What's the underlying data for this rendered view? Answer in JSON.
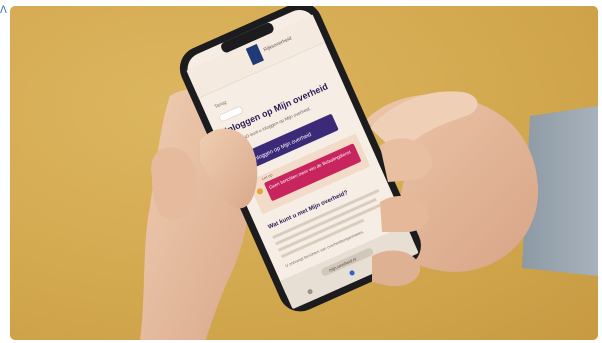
{
  "photo": {
    "subject": "hands-holding-smartphone",
    "colors": {
      "table": "#d4aa52",
      "skin": "#e9c3a6",
      "sleeve": "#9aa6b1",
      "phone": "#1c1c1f",
      "screen_bg": "#f6eee4",
      "primary_button": "#3a2a78",
      "alert_bar": "#c8245e",
      "alert_box": "#f2dcc9"
    },
    "screen": {
      "header_text": "Rijksoverheid",
      "back_link": "Terug",
      "heading": "Inloggen op Mijn overheid",
      "intro_text": "Met DigiD kunt u inloggen op Mijn overheid.",
      "login_button": "Inloggen op Mijn overheid",
      "alert_label": "Let op",
      "alert_text": "Geen berichten meer van de Belastingdienst",
      "section_heading": "Wat kunt u met Mijn overheid?",
      "body_text": "U ontvangt berichten van overheidsorganisaties.",
      "url_bar": "mijn.overheid.nl"
    }
  }
}
